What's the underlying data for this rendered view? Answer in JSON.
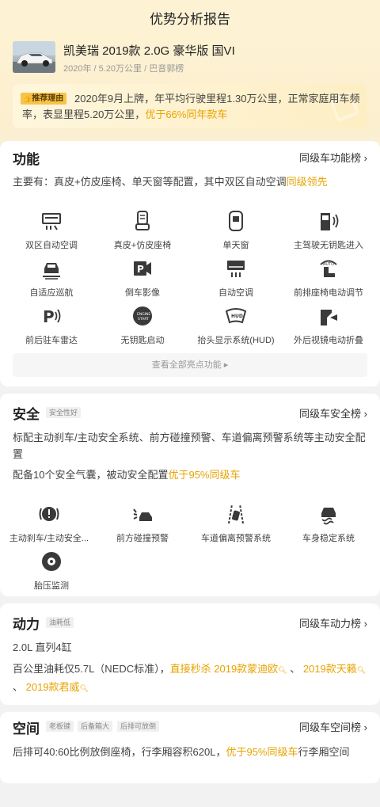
{
  "header": {
    "title": "优势分析报告",
    "car_name": "凯美瑞 2019款 2.0G 豪华版 国VI",
    "car_meta": "2020年 / 5.20万公里 / 巴音郭楞"
  },
  "reason": {
    "badge": "推荐理由",
    "text_main": "2020年9月上牌，年平均行驶里程1.30万公里，正常家庭用车频率，表显里程5.20万公里，",
    "text_highlight": "优于66%同年款车"
  },
  "function_section": {
    "title": "功能",
    "link": "同级车功能榜",
    "desc_main": "主要有：真皮+仿皮座椅、单天窗等配置，其中双区自动空调",
    "desc_highlight": "同级领先",
    "features": [
      {
        "label": "双区自动空调",
        "icon": "dual-zone-ac-icon"
      },
      {
        "label": "真皮+仿皮座椅",
        "icon": "leather-seat-icon"
      },
      {
        "label": "单天窗",
        "icon": "sunroof-icon"
      },
      {
        "label": "主驾驶无钥匙进入",
        "icon": "keyless-entry-icon"
      },
      {
        "label": "自适应巡航",
        "icon": "adaptive-cruise-icon"
      },
      {
        "label": "倒车影像",
        "icon": "reverse-camera-icon"
      },
      {
        "label": "自动空调",
        "icon": "auto-ac-icon"
      },
      {
        "label": "前排座椅电动调节",
        "icon": "power-seat-icon"
      },
      {
        "label": "前后驻车雷达",
        "icon": "parking-radar-icon"
      },
      {
        "label": "无钥匙启动",
        "icon": "keyless-start-icon"
      },
      {
        "label": "抬头显示系统(HUD)",
        "icon": "hud-icon"
      },
      {
        "label": "外后视镜电动折叠",
        "icon": "mirror-fold-icon"
      }
    ],
    "more_label": "查看全部亮点功能 ▸"
  },
  "safety_section": {
    "title": "安全",
    "tag": "安全性好",
    "link": "同级车安全榜",
    "desc_line1": "标配主动刹车/主动安全系统、前方碰撞预警、车道偏离预警系统等主动安全配置",
    "desc_line2_main": "配备10个安全气囊，被动安全配置",
    "desc_line2_highlight": "优于95%同级车",
    "features": [
      {
        "label": "主动刹车/主动安全...",
        "icon": "active-brake-icon"
      },
      {
        "label": "前方碰撞预警",
        "icon": "collision-warning-icon"
      },
      {
        "label": "车道偏离预警系统",
        "icon": "lane-departure-icon"
      },
      {
        "label": "车身稳定系统",
        "icon": "stability-control-icon"
      },
      {
        "label": "胎压监测",
        "icon": "tire-pressure-icon"
      }
    ]
  },
  "power_section": {
    "title": "动力",
    "tag": "油耗低",
    "link": "同级车动力榜",
    "engine": "2.0L 直列4缸",
    "desc_main": "百公里油耗仅5.7L（NEDC标准），",
    "desc_highlight1": "直接秒杀 2019款蒙迪欧",
    "desc_sep1": " 、 ",
    "desc_highlight2": "2019款天籁",
    "desc_sep2": " 、 ",
    "desc_highlight3": "2019款君威"
  },
  "space_section": {
    "title": "空间",
    "tags": [
      "老板键",
      "后备箱大",
      "后排可放倒"
    ],
    "link": "同级车空间榜",
    "desc_main": "后排可40:60比例放倒座椅，行李厢容积620L，",
    "desc_highlight": "优于95%同级车",
    "desc_tail": "行李厢空间"
  },
  "colors": {
    "accent": "#e8a300",
    "badge": "#f7c34a",
    "icon": "#3a3a3a"
  }
}
